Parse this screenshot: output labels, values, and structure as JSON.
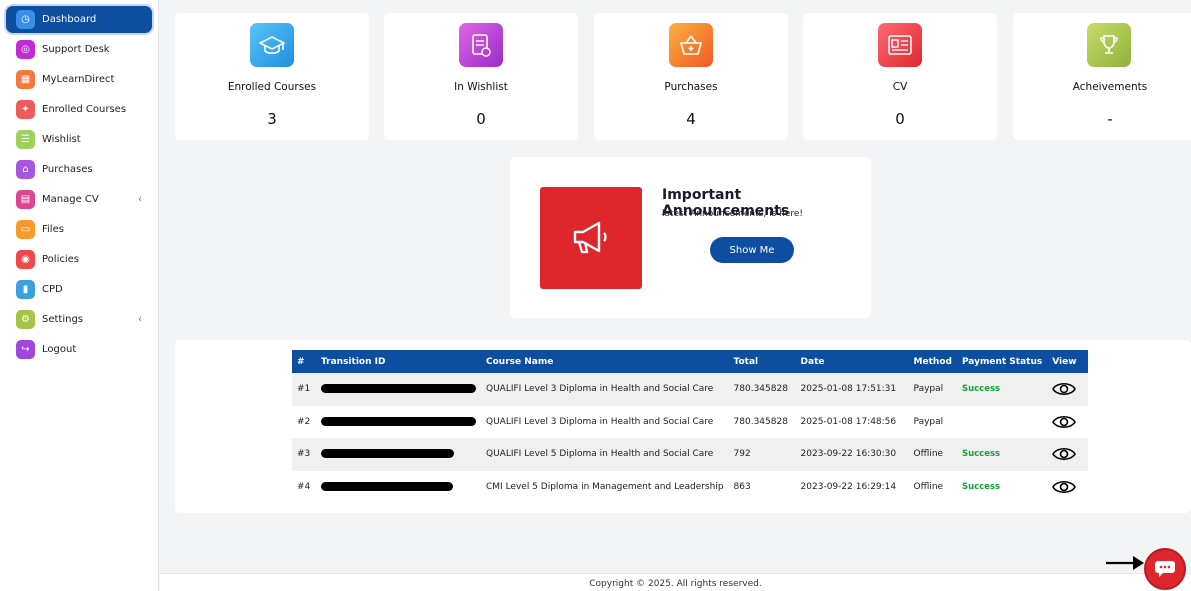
{
  "sidebar": {
    "items": [
      {
        "label": "Dashboard",
        "icon": "dashboard-icon",
        "color": "#3a8ee6"
      },
      {
        "label": "Support Desk",
        "icon": "support-icon",
        "color": "#c02cd1"
      },
      {
        "label": "MyLearnDirect",
        "icon": "learn-icon",
        "color": "#f07a3c"
      },
      {
        "label": "Enrolled Courses",
        "icon": "courses-icon",
        "color": "#ef5a5a"
      },
      {
        "label": "Wishlist",
        "icon": "wishlist-icon",
        "color": "#9bd15c"
      },
      {
        "label": "Purchases",
        "icon": "purchases-icon",
        "color": "#a557e0"
      },
      {
        "label": "Manage CV",
        "icon": "cv-icon",
        "color": "#e04690"
      },
      {
        "label": "Files",
        "icon": "files-icon",
        "color": "#f59a2b"
      },
      {
        "label": "Policies",
        "icon": "policies-icon",
        "color": "#f0474a"
      },
      {
        "label": "CPD",
        "icon": "cpd-icon",
        "color": "#3aa0e0"
      },
      {
        "label": "Settings",
        "icon": "settings-icon",
        "color": "#a8c34a"
      },
      {
        "label": "Logout",
        "icon": "logout-icon",
        "color": "#a244e0"
      }
    ]
  },
  "cards": [
    {
      "title": "Enrolled Courses",
      "value": "3",
      "icon": "graduation-cap-icon",
      "color": "#38a8f0"
    },
    {
      "title": "In Wishlist",
      "value": "0",
      "icon": "checklist-heart-icon",
      "color": "#c13ad8"
    },
    {
      "title": "Purchases",
      "value": "4",
      "icon": "basket-icon",
      "color": "#f5892b"
    },
    {
      "title": "CV",
      "value": "0",
      "icon": "cv-document-icon",
      "color": "#f04a55"
    },
    {
      "title": "Acheivements",
      "value": "-",
      "icon": "trophy-icon",
      "color": "#a8c84a"
    }
  ],
  "announcement": {
    "title": "Important Announcements",
    "subtitle": "latest Announcements, is here!",
    "button": "Show Me"
  },
  "table": {
    "headers": [
      "#",
      "Transition ID",
      "Course Name",
      "Total",
      "Date",
      "Method",
      "Payment Status",
      "View"
    ],
    "rows": [
      {
        "num": "#1",
        "course": "QUALIFI Level 3 Diploma in Health and Social Care",
        "total": "780.345828",
        "date": "2025-01-08 17:51:31",
        "method": "Paypal",
        "status": "Success"
      },
      {
        "num": "#2",
        "course": "QUALIFI Level 3 Diploma in Health and Social Care",
        "total": "780.345828",
        "date": "2025-01-08 17:48:56",
        "method": "Paypal",
        "status": ""
      },
      {
        "num": "#3",
        "course": "QUALIFI Level 5 Diploma in Health and Social Care",
        "total": "792",
        "date": "2023-09-22 16:30:30",
        "method": "Offline",
        "status": "Success"
      },
      {
        "num": "#4",
        "course": "CMI Level 5 Diploma in Management and Leadership",
        "total": "863",
        "date": "2023-09-22 16:29:14",
        "method": "Offline",
        "status": "Success"
      }
    ]
  },
  "footer": {
    "text": "Copyright © 2025. All rights reserved."
  },
  "colors": {
    "primary": "#0d4ea0",
    "success": "#1aa03a",
    "accent_red": "#e0262d"
  }
}
